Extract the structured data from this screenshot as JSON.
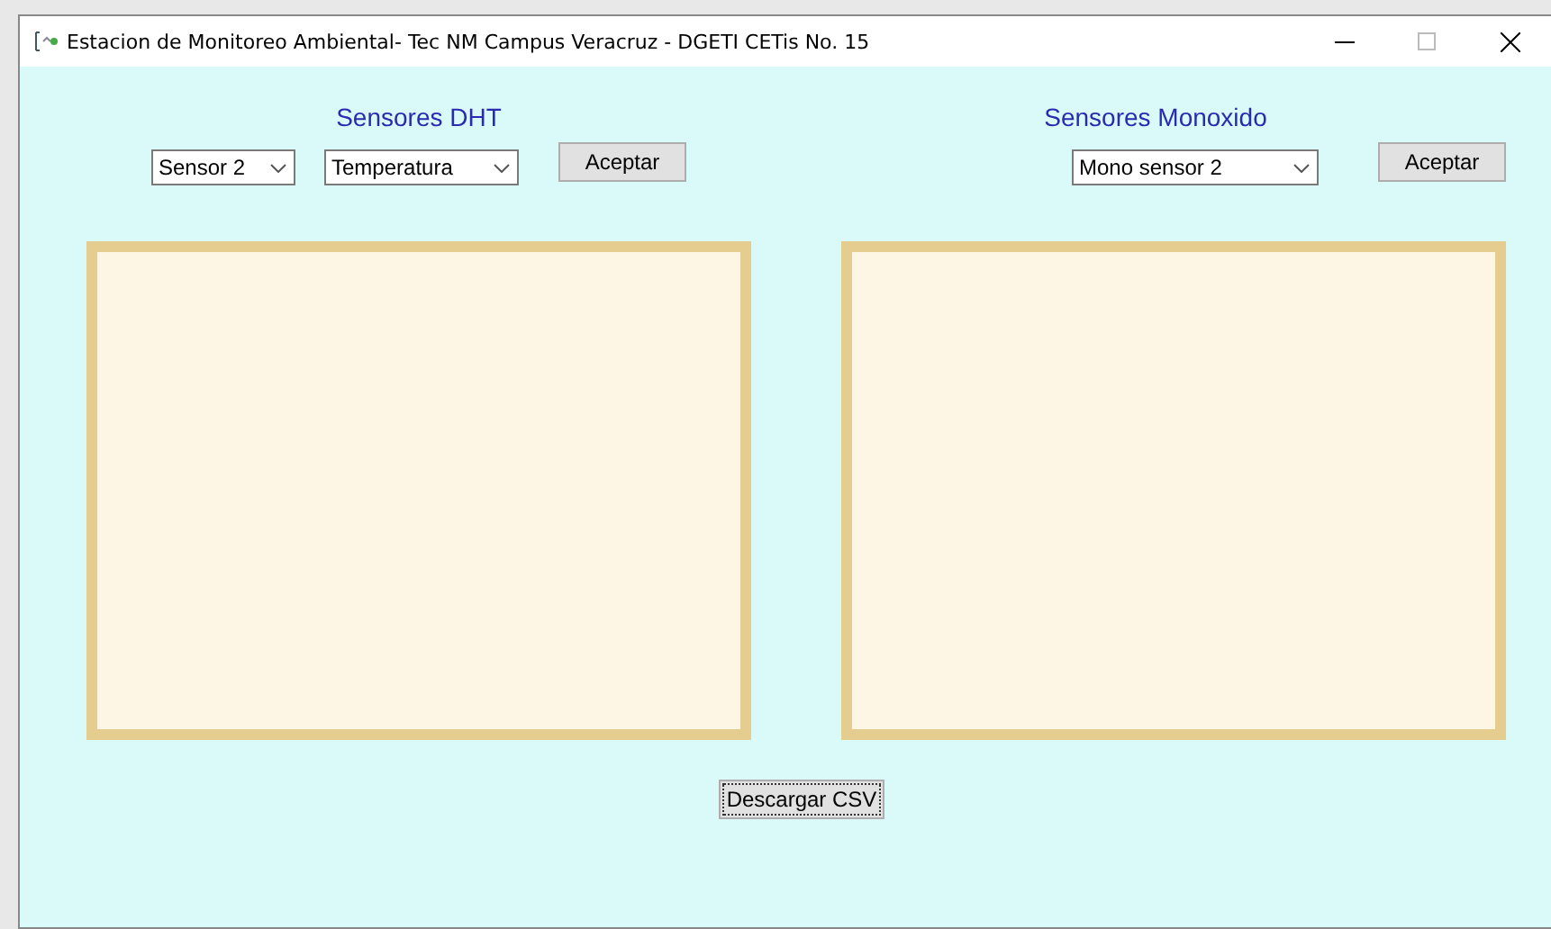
{
  "window": {
    "title": "Estacion de Monitoreo Ambiental- Tec NM Campus Veracruz - DGETI CETis No. 15"
  },
  "dht": {
    "title": "Sensores DHT",
    "sensor_select": "Sensor 2",
    "variable_select": "Temperatura",
    "button": "Aceptar"
  },
  "monoxido": {
    "title": "Sensores Monoxido",
    "sensor_select": "Mono sensor 2",
    "button": "Aceptar"
  },
  "download_button": "Descargar CSV"
}
